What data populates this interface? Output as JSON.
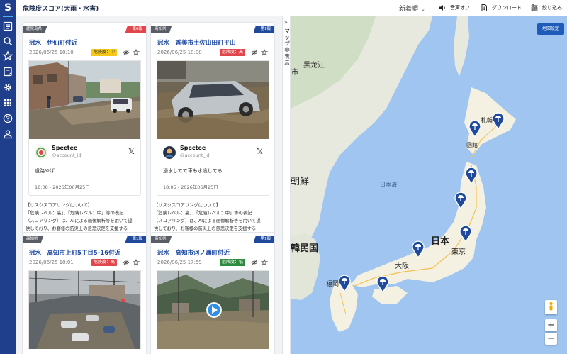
{
  "app": {
    "logo": "S"
  },
  "header": {
    "title": "危険度スコア(大雨・水害)",
    "sort_label": "新着順",
    "sound_label": "音声オフ",
    "download_label": "ダウンロード",
    "filter_label": "絞り込み"
  },
  "sidebar_icons": [
    "feed-icon",
    "search-icon",
    "star-icon",
    "report-icon",
    "gear-icon",
    "grid-icon",
    "help-icon",
    "user-icon"
  ],
  "divider": {
    "arrow": "»",
    "label": "マップ非表示"
  },
  "cards": [
    {
      "region": "鹿児島県",
      "rank": "第6報",
      "rank_color": "#e0464b",
      "title": "冠水　伊仙町付近",
      "date": "2026/06/25 18:10",
      "risk": "危険度：中",
      "risk_bg": "#f6c817",
      "risk_fg": "#333333",
      "tweet": {
        "name": "Spectee",
        "handle": "@account_id",
        "text": "道路やば",
        "time": "18:08 - 2026年06月25日"
      },
      "desc": [
        "【リスクスコアリングについて】",
        "「危険レベル：高」、「危険レベル：中」等の表記",
        "（スコアリング）は、AIによる画像解析等を用いて提",
        "供しており、お客様の防災上の意思決定を支援する"
      ]
    },
    {
      "region": "高知県",
      "rank": "第1報",
      "rank_color": "#1f4a9c",
      "title": "冠水　香美市土佐山田町平山",
      "date": "2026/06/25 18:08",
      "risk": "危険度：高",
      "risk_bg": "#e0464b",
      "risk_fg": "#ffffff",
      "tweet": {
        "name": "Spectee",
        "handle": "@account_id",
        "text": "浸水してて車も水没してる",
        "time": "18:05 - 2026年06月25日"
      },
      "desc": [
        "【リスクスコアリングについて】",
        "「危険レベル：高」、「危険レベル：中」等の表記",
        "（スコアリング）は、AIによる画像解析等を用いて提",
        "供しており、お客様の防災上の意思決定を支援する"
      ]
    },
    {
      "region": "高知県",
      "rank": "第1報",
      "rank_color": "#1f4a9c",
      "title": "冠水　高知市上町5丁目5-16付近",
      "date": "2026/06/25 18:01",
      "risk": "危険度：高",
      "risk_bg": "#e0464b",
      "risk_fg": "#ffffff"
    },
    {
      "region": "高知県",
      "rank": "第1報",
      "rank_color": "#1f4a9c",
      "title": "冠水　高知市河ノ瀬町付近",
      "date": "2026/06/25 17:59",
      "risk": "危険度：低",
      "risk_bg": "#2e8b3e",
      "risk_fg": "#ffffff"
    }
  ],
  "map": {
    "settings_label": "地図設定",
    "labels": {
      "heilongjiang": "黑龙江",
      "sea_of_japan": "日本海",
      "korea": "韓民国",
      "nkorea": "朝鮮",
      "japan": "日本",
      "tokyo": "東京",
      "osaka": "大阪",
      "fukuoka": "福岡",
      "sapporo": "札幌",
      "hakodate": "函館",
      "city_fragment": "市"
    },
    "zoom_in": "+",
    "zoom_out": "−"
  }
}
